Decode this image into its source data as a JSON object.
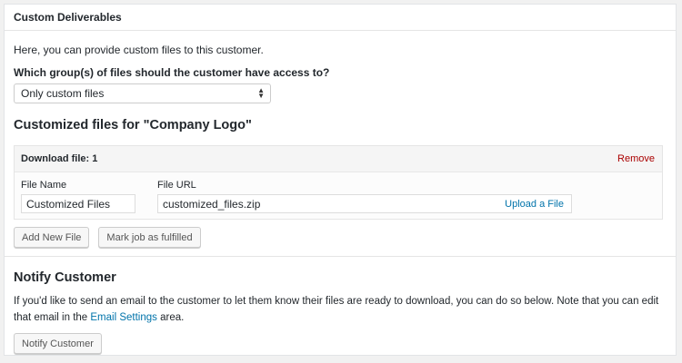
{
  "panel": {
    "title": "Custom Deliverables"
  },
  "intro": {
    "text": "Here, you can provide custom files to this customer."
  },
  "access": {
    "question": "Which group(s) of files should the customer have access to?",
    "selected": "Only custom files"
  },
  "custom_files": {
    "heading": "Customized files for \"Company Logo\"",
    "download_label": "Download file: 1",
    "remove_label": "Remove",
    "file_name_label": "File Name",
    "file_url_label": "File URL",
    "file_name_value": "Customized Files",
    "file_url_value": "customized_files.zip",
    "upload_label": "Upload a File"
  },
  "buttons": {
    "add_new_file": "Add New File",
    "mark_fulfilled": "Mark job as fulfilled"
  },
  "notify": {
    "heading": "Notify Customer",
    "text_before": "If you'd like to send an email to the customer to let them know their files are ready to download, you can do so below. Note that you can edit that email in the ",
    "link_text": "Email Settings",
    "text_after": " area.",
    "button_label": "Notify Customer"
  },
  "colors": {
    "link": "#0073aa",
    "remove": "#aa0000",
    "border": "#e5e5e5"
  }
}
